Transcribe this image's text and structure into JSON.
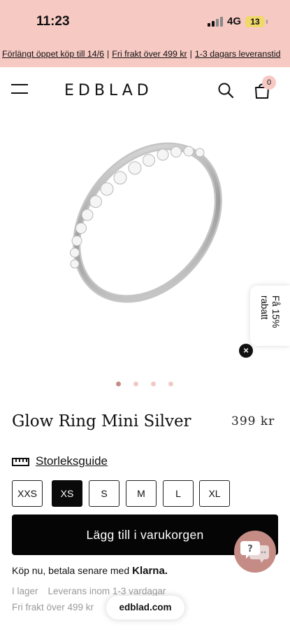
{
  "status_bar": {
    "time": "11:23",
    "network": "4G",
    "battery": "13"
  },
  "promo": {
    "items": [
      "Förlängt öppet köp till 14/6",
      "Fri frakt över 499 kr",
      "1-3 dagars leveranstid"
    ],
    "separator": "|"
  },
  "header": {
    "logo": "EDBLAD",
    "cart_count": "0"
  },
  "side_tab": {
    "label": "Få 15% rabatt",
    "close_label": "×"
  },
  "carousel": {
    "count": 4,
    "active_index": 0
  },
  "product": {
    "title": "Glow Ring Mini Silver",
    "price": "399 kr"
  },
  "size_guide": {
    "label": "Storleksguide"
  },
  "sizes": {
    "options": [
      "XXS",
      "XS",
      "S",
      "M",
      "L",
      "XL"
    ],
    "selected": "XS"
  },
  "cta": {
    "add_to_cart": "Lägg till i varukorgen"
  },
  "klarna": {
    "text": "Köp nu, betala senare med",
    "brand": "Klarna."
  },
  "stock": {
    "status": "I lager",
    "delivery": "Leverans inom 1-3 vardagar",
    "shipping": "Fri frakt över 499 kr"
  },
  "browser": {
    "url": "edblad.com"
  },
  "colors": {
    "promo_bg": "#f7c9c3",
    "accent": "#c58c86",
    "cta_bg": "#050505"
  }
}
